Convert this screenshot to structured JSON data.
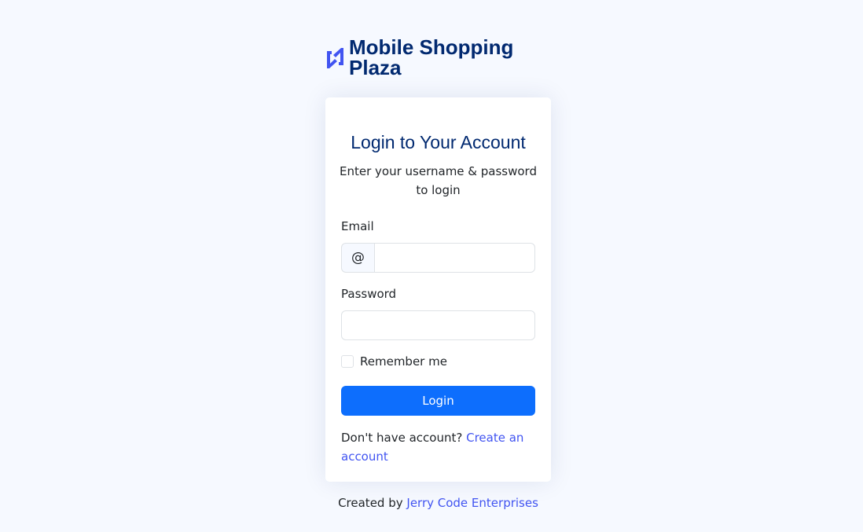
{
  "brand": {
    "name": "Mobile Shopping Plaza",
    "logo_icon": "logo-icon",
    "color": "#012970"
  },
  "card": {
    "title": "Login to Your Account",
    "subtitle": "Enter your username & password to login"
  },
  "form": {
    "email_label": "Email",
    "email_addon": "@",
    "email_value": "",
    "password_label": "Password",
    "password_value": "",
    "remember_label": "Remember me",
    "remember_checked": false,
    "login_label": "Login"
  },
  "signup": {
    "prompt": "Don't have account?",
    "link_label": "Create an account"
  },
  "footer": {
    "prefix": "Created by",
    "link_label": "Jerry Code Enterprises"
  },
  "colors": {
    "accent": "#0d6efd",
    "link": "#4154f1",
    "background": "#f6f9ff"
  }
}
